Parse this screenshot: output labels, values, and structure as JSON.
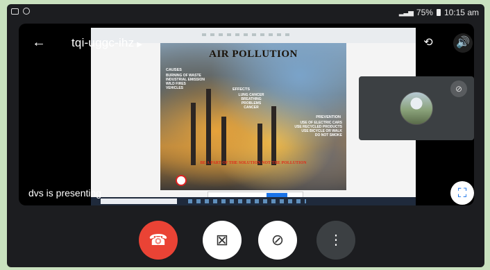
{
  "status_bar": {
    "battery": "75%",
    "time": "10:15 am"
  },
  "meeting": {
    "code": "tqi-uggc-ihz",
    "presenter_text": "dvs is presenting"
  },
  "slide": {
    "title": "AIR POLLUTION",
    "causes_heading": "CAUSES",
    "causes": "BURNING OF WASTE\nINDUSTRIAL EMISSION\nWILD FIRES\nVEHICLES",
    "effects_heading": "EFFECTS",
    "effects": "LUNG CANCER\nBREATHING\nPROBLEMS\nCANCER",
    "prevention_heading": "PREVENTION",
    "prevention": "USE OF ELECTRIC CARS\nUSE RECYCLED PRODUCTS\nUSE BICYCLE OR WALK\nDO NOT SMOKE",
    "banner": "BE A PART OF THE SOLUTION NOT THE POLLUTION"
  },
  "colors": {
    "end_call": "#ea4335",
    "accent": "#1a73e8"
  },
  "icons": {
    "back": "back-arrow-icon",
    "switch_camera": "switch-camera-icon",
    "speaker": "speaker-icon",
    "mic_off": "mic-off-icon",
    "camera_off": "camera-off-icon",
    "end_call": "end-call-icon",
    "more": "more-vertical-icon",
    "layout": "layout-icon"
  }
}
